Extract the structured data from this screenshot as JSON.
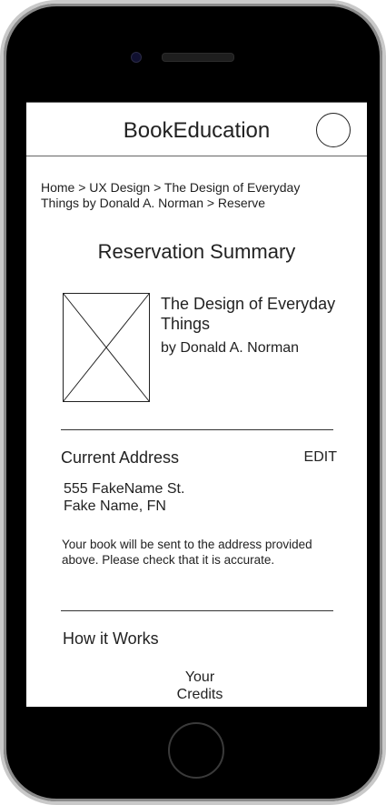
{
  "header": {
    "app_title": "BookEducation"
  },
  "breadcrumb": {
    "text": "Home > UX Design > The Design of Everyday Things by Donald A. Norman > Reserve"
  },
  "page": {
    "title": "Reservation Summary"
  },
  "book": {
    "title": "The Design of Everyday Things",
    "author": "by Donald A. Norman",
    "cover_icon": "image-placeholder-icon"
  },
  "address_section": {
    "heading": "Current Address",
    "edit_label": "EDIT",
    "line1": "555 FakeName St.",
    "line2": "Fake Name, FN",
    "note": "Your book will be sent to the address provided above. Please check that it is accurate."
  },
  "how_it_works": {
    "heading": "How it Works",
    "credits_line1": "Your",
    "credits_line2": "Credits"
  }
}
